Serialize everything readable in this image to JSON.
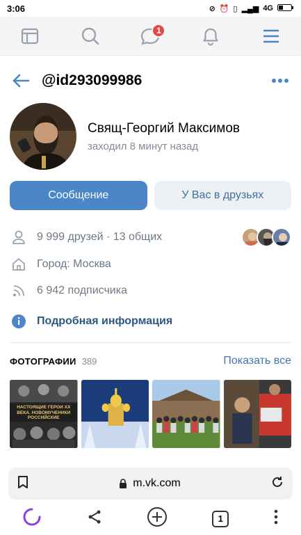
{
  "status_bar": {
    "time": "3:06",
    "network": "4G"
  },
  "nav": {
    "messages_badge": "1"
  },
  "header": {
    "title": "@id293099986"
  },
  "profile": {
    "name": "Свящ-Георгий Максимов",
    "status": "заходил 8 минут назад"
  },
  "actions": {
    "message": "Сообщение",
    "friends": "У Вас в друзьях"
  },
  "info": {
    "friends": "9 999 друзей · 13 общих",
    "city": "Город: Москва",
    "followers": "6 942 подписчика",
    "details": "Подробная информация"
  },
  "photos": {
    "title": "ФОТОГРАФИИ",
    "count": "389",
    "show_all": "Показать все",
    "items": [
      {
        "caption": "НАСТОЯЩИЕ ГЕРОИ XX ВЕКА. НОВОМУЧЕНИКИ РОССИЙСКИЕ"
      }
    ]
  },
  "browser": {
    "url": "m.vk.com",
    "tabs": "1"
  },
  "colors": {
    "accent": "#4a86c8",
    "link": "#2a5885",
    "badge": "#e64646"
  }
}
